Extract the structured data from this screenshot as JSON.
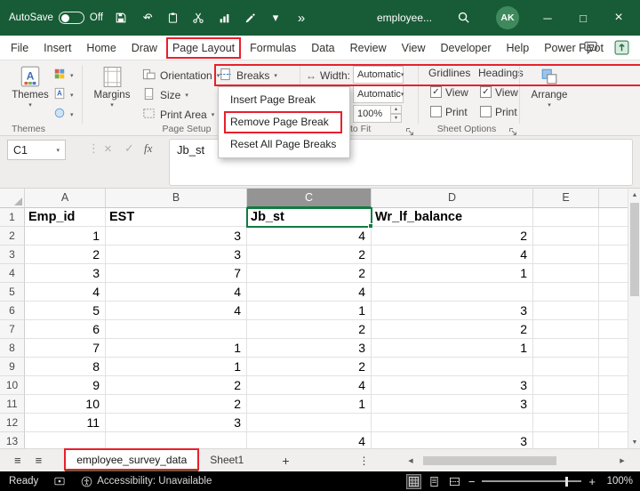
{
  "colors": {
    "title_bar_green": "#185C37",
    "accent_green": "#107C41",
    "annotation_red": "#e8202c",
    "status_bar": "#000000"
  },
  "icons": {
    "chevron_down": "▾",
    "undo": "↶",
    "overflow": "»",
    "minimize": "─",
    "maximize": "□",
    "close": "×",
    "ellipsis_v": "⋮",
    "cancel": "×",
    "check": "✓",
    "width_arrows": "↔",
    "nav_list": "≡",
    "scroll_up": "▲",
    "scroll_down": "▼",
    "scroll_left": "◀",
    "scroll_right": "▶",
    "spinner_up": "▲",
    "spinner_down": "▼",
    "zoom_out": "−",
    "zoom_in": "+"
  },
  "title_bar": {
    "autosave_label": "AutoSave",
    "autosave_state": "Off",
    "document_title": "employee...",
    "avatar_initials": "AK"
  },
  "menu_bar": {
    "items": [
      "File",
      "Insert",
      "Home",
      "Draw",
      "Page Layout",
      "Formulas",
      "Data",
      "Review",
      "View",
      "Developer",
      "Help",
      "Power Pivot"
    ],
    "active": "Page Layout"
  },
  "ribbon": {
    "buttons": {
      "themes": "Themes",
      "margins": "Margins",
      "orientation": "Orientation",
      "size": "Size",
      "print_area": "Print Area",
      "breaks": "Breaks",
      "arrange": "Arrange"
    },
    "scale_to_fit": {
      "width_label": "Width:",
      "width_value": "Automatic",
      "height_value": "Automatic",
      "scale_value": "100%"
    },
    "sheet_options": {
      "gridlines_label": "Gridlines",
      "headings_label": "Headings",
      "gridlines_view": "View",
      "gridlines_print": "Print",
      "headings_view": "View",
      "headings_print": "Print",
      "gridlines_view_checked": true,
      "gridlines_print_checked": false,
      "headings_view_checked": true,
      "headings_print_checked": false
    },
    "group_labels": {
      "themes": "Themes",
      "page_setup": "Page Setup",
      "scale_to_fit_visible": "to Fit",
      "sheet_options": "Sheet Options"
    }
  },
  "breaks_menu": {
    "items": [
      "Insert Page Break",
      "Remove Page Break",
      "Reset All Page Breaks"
    ],
    "highlighted": "Remove Page Break"
  },
  "formula_bar": {
    "name_box": "C1",
    "fx_label": "fx",
    "content": "Jb_st"
  },
  "sheet": {
    "columns": [
      "A",
      "B",
      "C",
      "D",
      "E"
    ],
    "selected_column": "C",
    "selected_cell": "C1",
    "header_row": {
      "num": "1",
      "a": "Emp_id",
      "b": "EST",
      "c": "Jb_st",
      "d": "Wr_lf_balance",
      "e": ""
    },
    "rows": [
      {
        "num": "2",
        "a": "1",
        "b": "3",
        "c": "4",
        "d": "2",
        "e": ""
      },
      {
        "num": "3",
        "a": "2",
        "b": "3",
        "c": "2",
        "d": "4",
        "e": ""
      },
      {
        "num": "4",
        "a": "3",
        "b": "7",
        "c": "2",
        "d": "1",
        "e": ""
      },
      {
        "num": "5",
        "a": "4",
        "b": "4",
        "c": "4",
        "d": "",
        "e": ""
      },
      {
        "num": "6",
        "a": "5",
        "b": "4",
        "c": "1",
        "d": "3",
        "e": ""
      },
      {
        "num": "7",
        "a": "6",
        "b": "",
        "c": "2",
        "d": "2",
        "e": ""
      },
      {
        "num": "8",
        "a": "7",
        "b": "1",
        "c": "3",
        "d": "1",
        "e": ""
      },
      {
        "num": "9",
        "a": "8",
        "b": "1",
        "c": "2",
        "d": "",
        "e": ""
      },
      {
        "num": "10",
        "a": "9",
        "b": "2",
        "c": "4",
        "d": "3",
        "e": ""
      },
      {
        "num": "11",
        "a": "10",
        "b": "2",
        "c": "1",
        "d": "3",
        "e": ""
      },
      {
        "num": "12",
        "a": "11",
        "b": "3",
        "c": "",
        "d": "",
        "e": ""
      },
      {
        "num": "13",
        "a": "",
        "b": "",
        "c": "4",
        "d": "3",
        "e": ""
      }
    ]
  },
  "tab_bar": {
    "tabs": [
      {
        "label": "employee_survey_data",
        "active": true
      },
      {
        "label": "Sheet1",
        "active": false
      }
    ],
    "add_label": "+"
  },
  "status_bar": {
    "mode": "Ready",
    "accessibility": "Accessibility: Unavailable",
    "zoom": "100%"
  }
}
